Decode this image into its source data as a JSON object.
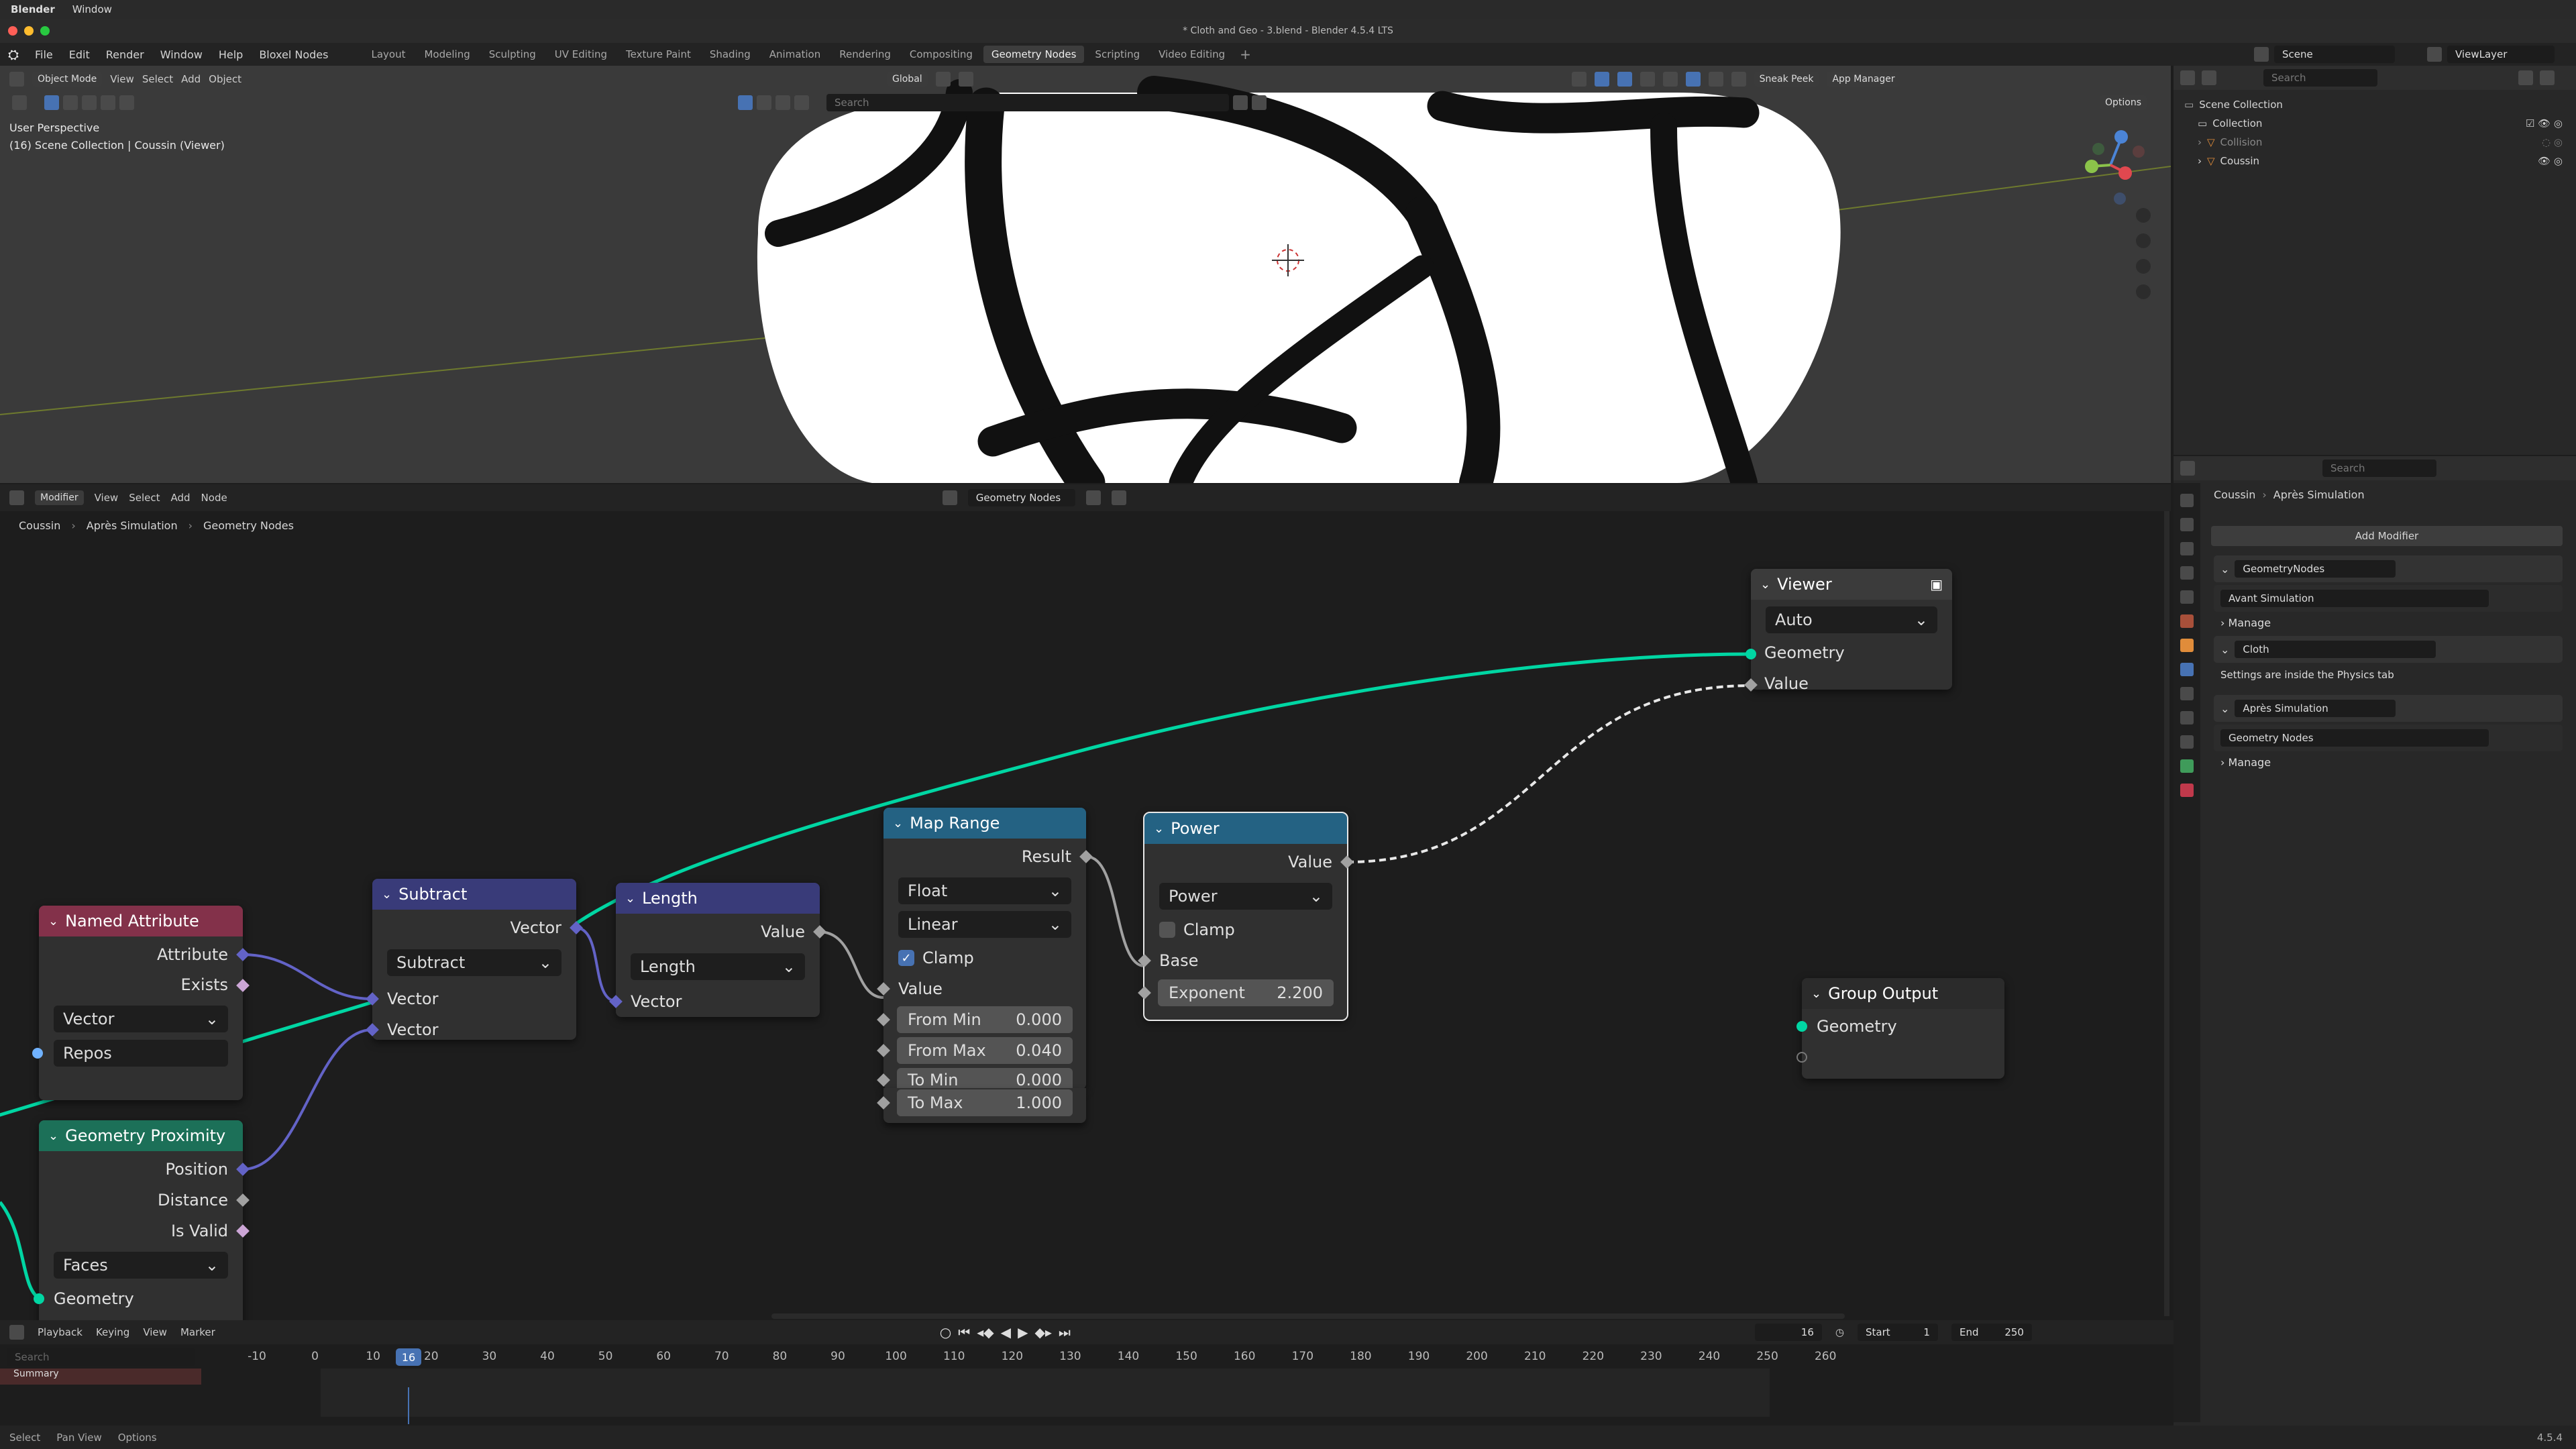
{
  "mac": {
    "app": "Blender",
    "window_menu": "Window"
  },
  "window_title": "* Cloth and Geo - 3.blend - Blender 4.5.4 LTS",
  "menu": {
    "file": "File",
    "edit": "Edit",
    "render": "Render",
    "window": "Window",
    "help": "Help",
    "bloxel": "Bloxel Nodes"
  },
  "workspaces": [
    "Layout",
    "Modeling",
    "Sculpting",
    "UV Editing",
    "Texture Paint",
    "Shading",
    "Animation",
    "Rendering",
    "Compositing",
    "Geometry Nodes",
    "Scripting",
    "Video Editing"
  ],
  "active_workspace": "Geometry Nodes",
  "scene": {
    "scene": "Scene",
    "view_layer": "ViewLayer"
  },
  "viewport": {
    "mode": "Object Mode",
    "view": "View",
    "select": "Select",
    "add": "Add",
    "object": "Object",
    "orientation": "Global",
    "search_placeholder": "Search",
    "sneak_peek": "Sneak Peek",
    "app_manager": "App Manager",
    "options": "Options",
    "perspective": "User Perspective",
    "collection_info": "(16) Scene Collection | Coussin (Viewer)"
  },
  "outliner": {
    "search_placeholder": "Search",
    "items": [
      "Scene Collection",
      "Collection",
      "Collision",
      "Coussin"
    ]
  },
  "node_editor": {
    "editor": "Modifier",
    "view": "View",
    "select": "Select",
    "add": "Add",
    "node": "Node",
    "tree_name": "Geometry Nodes",
    "breadcrumb": [
      "Coussin",
      "Après Simulation",
      "Geometry Nodes"
    ]
  },
  "nodes": {
    "viewer": {
      "title": "Viewer",
      "domain": "Auto",
      "geometry": "Geometry",
      "value": "Value"
    },
    "named_attribute": {
      "title": "Named Attribute",
      "attribute": "Attribute",
      "exists": "Exists",
      "type": "Vector",
      "name": "Repos"
    },
    "subtract": {
      "title": "Subtract",
      "out": "Vector",
      "op": "Subtract",
      "in1": "Vector",
      "in2": "Vector"
    },
    "length": {
      "title": "Length",
      "out": "Value",
      "op": "Length",
      "in": "Vector"
    },
    "map_range": {
      "title": "Map Range",
      "out": "Result",
      "data_type": "Float",
      "interp": "Linear",
      "clamp_label": "Clamp",
      "clamp": true,
      "value": "Value",
      "from_min_label": "From Min",
      "from_min": "0.000",
      "from_max_label": "From Max",
      "from_max": "0.040",
      "to_min_label": "To Min",
      "to_min": "0.000",
      "to_max_label": "To Max",
      "to_max": "1.000"
    },
    "power": {
      "title": "Power",
      "out": "Value",
      "op": "Power",
      "clamp_label": "Clamp",
      "clamp": false,
      "base": "Base",
      "exponent_label": "Exponent",
      "exponent": "2.200"
    },
    "geometry_proximity": {
      "title": "Geometry Proximity",
      "position": "Position",
      "distance": "Distance",
      "is_valid": "Is Valid",
      "target": "Faces",
      "geometry": "Geometry"
    },
    "group_output": {
      "title": "Group Output",
      "geometry": "Geometry"
    }
  },
  "properties": {
    "search_placeholder": "Search",
    "breadcrumb": [
      "Coussin",
      "Après Simulation"
    ],
    "add_modifier": "Add Modifier",
    "modifiers": [
      {
        "name": "GeometryNodes",
        "tree": "Avant Simulation",
        "manage": "Manage"
      },
      {
        "name": "Cloth",
        "note": "Settings are inside the Physics tab"
      },
      {
        "name": "Après Simulation",
        "tree": "Geometry Nodes",
        "manage": "Manage"
      }
    ]
  },
  "timeline": {
    "playback": "Playback",
    "keying": "Keying",
    "view": "View",
    "marker": "Marker",
    "current_frame": "16",
    "start_label": "Start",
    "start": "1",
    "end_label": "End",
    "end": "250",
    "search_placeholder": "Search",
    "summary": "Summary",
    "ticks": [
      "-10",
      "0",
      "10",
      "20",
      "30",
      "40",
      "50",
      "60",
      "70",
      "80",
      "90",
      "100",
      "110",
      "120",
      "130",
      "140",
      "150",
      "160",
      "170",
      "180",
      "190",
      "200",
      "210",
      "220",
      "230",
      "240",
      "250",
      "260"
    ]
  },
  "status": {
    "select": "Select",
    "pan": "Pan View",
    "options": "Options",
    "version": "4.5.4"
  },
  "colors": {
    "accent": "#4772b3",
    "geometry_socket": "#00d6a3",
    "vector_socket": "#6363c7",
    "float_socket": "#a1a1a1",
    "bool_socket": "#cca6d6"
  }
}
